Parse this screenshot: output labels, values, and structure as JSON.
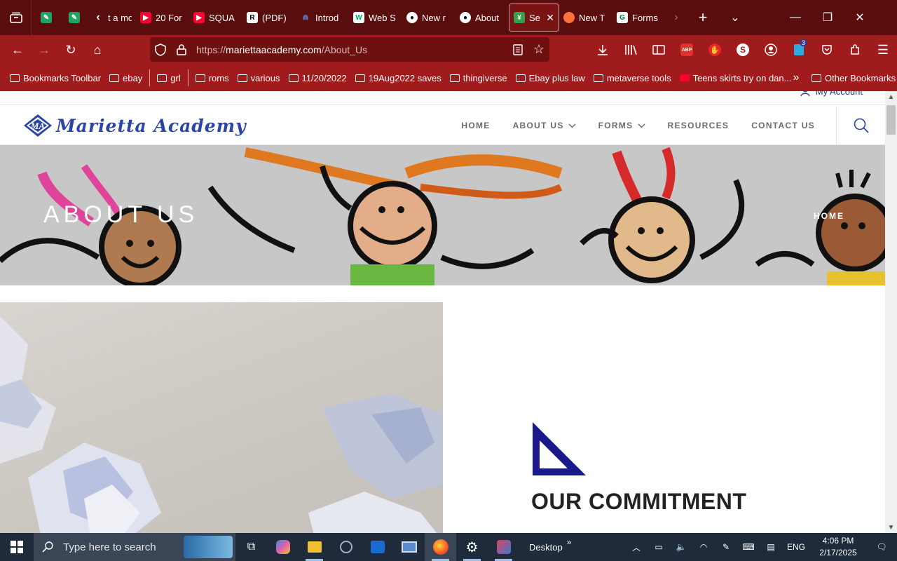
{
  "tabs": [
    {
      "label": "",
      "icon": "sheets-icon",
      "pinned": true
    },
    {
      "label": "",
      "icon": "sheets-icon",
      "pinned": true
    },
    {
      "label": "t a mor",
      "icon": "chevron-left-icon"
    },
    {
      "label": "20 For",
      "icon": "youtube-icon"
    },
    {
      "label": "SQUA",
      "icon": "youtube-icon"
    },
    {
      "label": "(PDF)",
      "icon": "researchgate-icon"
    },
    {
      "label": "Introd",
      "icon": "nodes-icon"
    },
    {
      "label": "Web S",
      "icon": "w3schools-icon"
    },
    {
      "label": "New r",
      "icon": "github-icon"
    },
    {
      "label": "About",
      "icon": "github-icon"
    },
    {
      "label": "Ser",
      "icon": "site-icon",
      "active": true
    },
    {
      "label": "New T",
      "icon": "firefox-icon"
    },
    {
      "label": "Forms",
      "icon": "forms-icon"
    }
  ],
  "url": {
    "scheme": "https://",
    "host": "mariettaacademy.com",
    "path": "/About_Us"
  },
  "bookmarks": {
    "items": [
      "Bookmarks Toolbar",
      "ebay",
      "grl",
      "roms",
      "various",
      "11/20/2022",
      "19Aug2022 saves",
      "thingiverse",
      "Ebay plus law",
      "metaverse tools",
      "Teens skirts try on dan..."
    ],
    "other": "Other Bookmarks"
  },
  "toolbar": {
    "extension_badge": "3",
    "abp_label": "ABP"
  },
  "site": {
    "my_account": "My Account",
    "logo_text": "Marietta Academy",
    "logo_mark": "MA",
    "menu": [
      "HOME",
      "ABOUT US",
      "FORMS",
      "RESOURCES",
      "CONTACT US"
    ],
    "hero_title": "ABOUT US",
    "hero_breadcrumb": "HOME",
    "section_title": "OUR COMMITMENT"
  },
  "taskbar": {
    "search_placeholder": "Type here to search",
    "desktop_label": "Desktop",
    "language": "ENG",
    "time": "4:06 PM",
    "date": "2/17/2025"
  },
  "colors": {
    "tab_bg": "#5a0d0d",
    "toolbar_bg": "#a01b1b",
    "brand_blue": "#2a44a8",
    "accent_navy": "#1a1a8a"
  }
}
